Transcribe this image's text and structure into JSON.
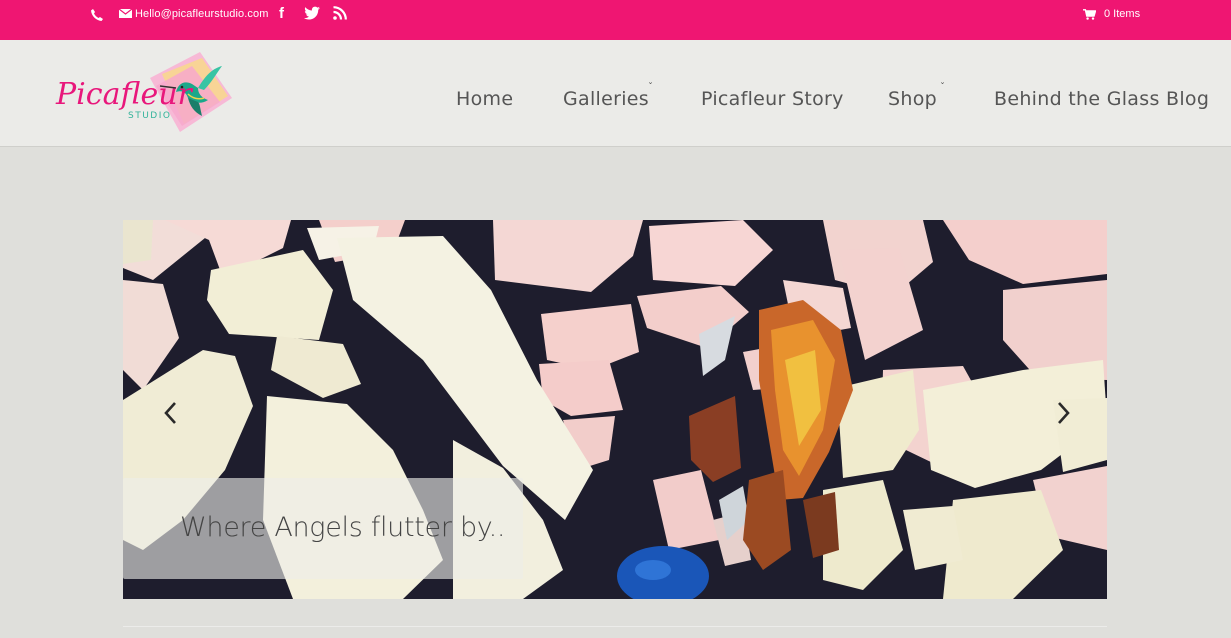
{
  "topbar": {
    "email": "Hello@picafleurstudio.com",
    "facebook_glyph": "f",
    "cart_count": "0 Items",
    "icons": [
      "phone-icon",
      "mail-icon",
      "facebook-icon",
      "twitter-icon",
      "rss-icon",
      "cart-icon"
    ]
  },
  "header": {
    "logo_text": "Picafleur",
    "logo_subtext": "STUDIO",
    "nav": [
      {
        "label": "Home",
        "has_dropdown": false
      },
      {
        "label": "Galleries",
        "has_dropdown": true
      },
      {
        "label": "Picafleur Story",
        "has_dropdown": false
      },
      {
        "label": "Shop",
        "has_dropdown": true
      },
      {
        "label": "Behind the Glass Blog",
        "has_dropdown": false
      }
    ],
    "dropdown_glyph": "ˇ"
  },
  "slider": {
    "caption": "Where Angels flutter by.."
  },
  "colors": {
    "topbar_bg": "#ef1672",
    "header_bg": "#ebebe8",
    "page_bg": "#dfdfdb",
    "nav_text": "#555555"
  }
}
